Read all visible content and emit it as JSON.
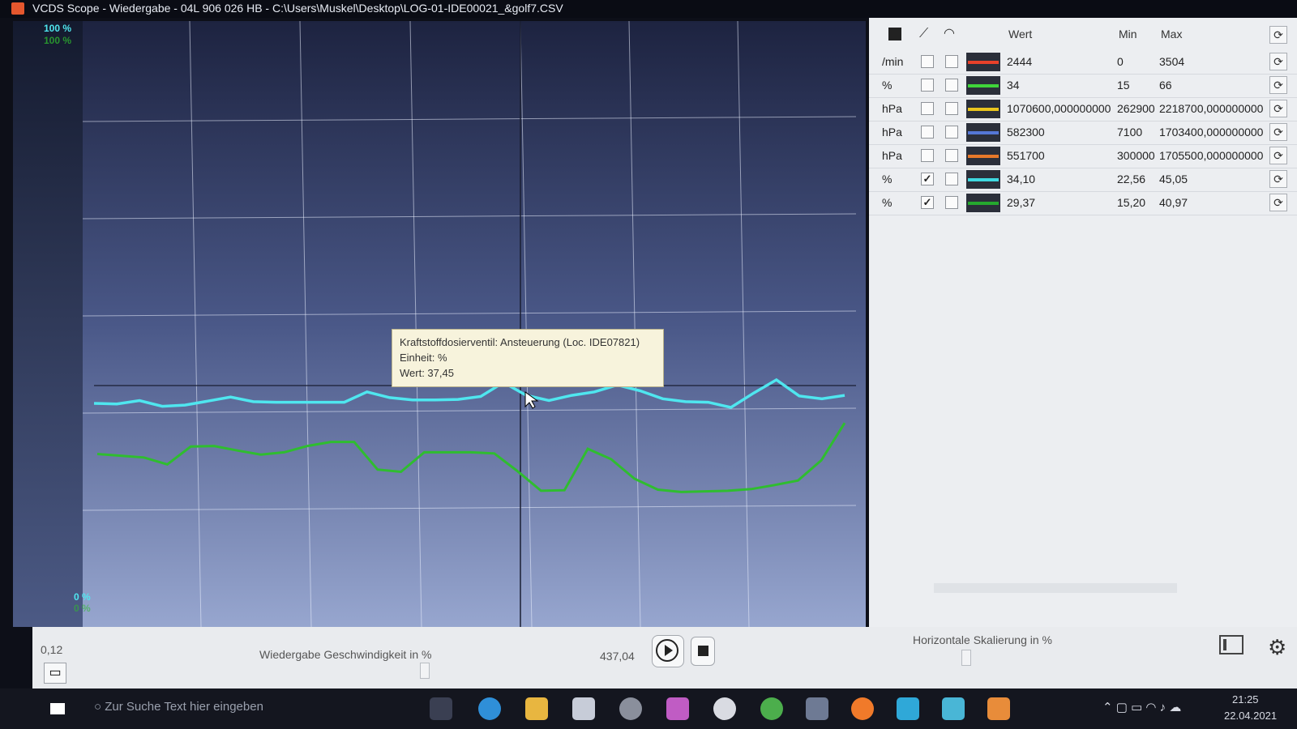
{
  "window": {
    "title": "VCDS Scope - Wiedergabe - 04L 906 026 HB - C:\\Users\\Muskel\\Desktop\\LOG-01-IDE00021_&golf7.CSV"
  },
  "chart": {
    "y_top_label": "100 %",
    "y_top_label2": "100 %",
    "y_bottom_label": "0 %",
    "y_bottom_label2": "0 %"
  },
  "tooltip": {
    "line1": "Kraftstoffdosierventil: Ansteuerung (Loc. IDE07821)",
    "line2": "Einheit:  %",
    "line3": "Wert: 37,45"
  },
  "table": {
    "headers": {
      "wert": "Wert",
      "min": "Min",
      "max": "Max"
    },
    "rows": [
      {
        "unit": "/min",
        "plot": false,
        "gauge": false,
        "color": "#e8412a",
        "wert": "2444",
        "min": "0",
        "max": "3504"
      },
      {
        "unit": "%",
        "plot": false,
        "gauge": false,
        "color": "#3fd43a",
        "wert": "34",
        "min": "15",
        "max": "66"
      },
      {
        "unit": "hPa",
        "plot": false,
        "gauge": false,
        "color": "#e9c51e",
        "wert": "1070600,000000000",
        "min": "262900",
        "max": "2218700,000000000"
      },
      {
        "unit": "hPa",
        "plot": false,
        "gauge": false,
        "color": "#5577d6",
        "wert": "582300",
        "min": "7100",
        "max": "1703400,000000000"
      },
      {
        "unit": "hPa",
        "plot": false,
        "gauge": false,
        "color": "#e7782a",
        "wert": "551700",
        "min": "300000",
        "max": "1705500,000000000"
      },
      {
        "unit": "%",
        "plot": true,
        "gauge": false,
        "color": "#3fd8e0",
        "wert": "34,10",
        "min": "22,56",
        "max": "45,05"
      },
      {
        "unit": "%",
        "plot": true,
        "gauge": false,
        "color": "#25a82e",
        "wert": "29,37",
        "min": "15,20",
        "max": "40,97"
      }
    ]
  },
  "bottom": {
    "left_value": "0,12",
    "speed_label": "Wiedergabe Geschwindigkeit in %",
    "time_value": "437,04",
    "hscale_label": "Horizontale Skalierung in %"
  },
  "taskbar": {
    "search_placeholder": "Zur Suche Text hier eingeben",
    "time": "21:25",
    "date": "22.04.2021"
  },
  "series": {
    "cyan": {
      "color": "#4fe6ef",
      "values": [
        33.8,
        33.7,
        34.3,
        33.3,
        33.5,
        34.2,
        34.9,
        34.1,
        34.0,
        34.0,
        34.0,
        34.0,
        35.8,
        34.8,
        34.4,
        34.4,
        34.5,
        35.0,
        37.45,
        35.2,
        34.3,
        35.2,
        35.8,
        37.0,
        36.0,
        34.6,
        34.1,
        34.0,
        33.1,
        35.6,
        37.9,
        35.1,
        34.6,
        35.2
      ]
    },
    "green": {
      "color": "#2fbd2f",
      "values": [
        25.0,
        24.7,
        24.4,
        23.2,
        26.3,
        26.4,
        25.6,
        24.9,
        25.3,
        26.4,
        27.1,
        27.1,
        22.3,
        21.9,
        25.3,
        25.3,
        25.3,
        25.1,
        22.0,
        18.6,
        18.7,
        25.9,
        24.1,
        20.7,
        18.8,
        18.4,
        18.5,
        18.6,
        18.9,
        19.6,
        20.4,
        23.9,
        30.4
      ]
    }
  }
}
